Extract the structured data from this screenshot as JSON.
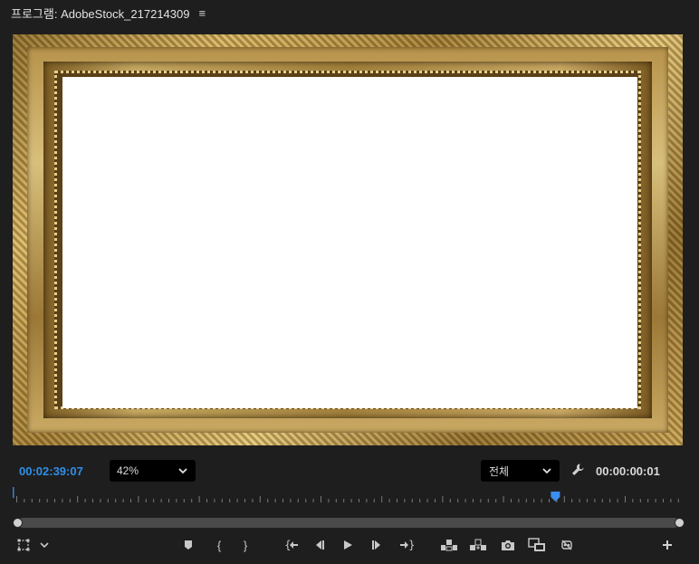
{
  "header": {
    "title": "프로그램: AdobeStock_217214309",
    "menu_icon": "hamburger-icon"
  },
  "controls": {
    "current_timecode": "00:02:39:07",
    "zoom_value": "42%",
    "quality_value": "전체",
    "duration_timecode": "00:00:00:01"
  },
  "ruler": {
    "playhead_position": 0.81
  },
  "colors": {
    "accent": "#2f8fe8",
    "panel_bg": "#1e1e1e",
    "frame_gold": "#c9a963"
  },
  "icons": {
    "settings": "wrench-icon",
    "safe_margins": "safe-margins-icon",
    "marker": "add-marker-icon",
    "mark_in": "mark-in-icon",
    "mark_out": "mark-out-icon",
    "go_to_in": "go-to-in-icon",
    "step_back": "step-back-icon",
    "play": "play-icon",
    "step_forward": "step-forward-icon",
    "go_to_out": "go-to-out-icon",
    "lift": "lift-icon",
    "extract": "extract-icon",
    "export_frame": "camera-icon",
    "compare": "comparison-view-icon",
    "vr": "vr-icon",
    "add_button": "plus-icon"
  }
}
